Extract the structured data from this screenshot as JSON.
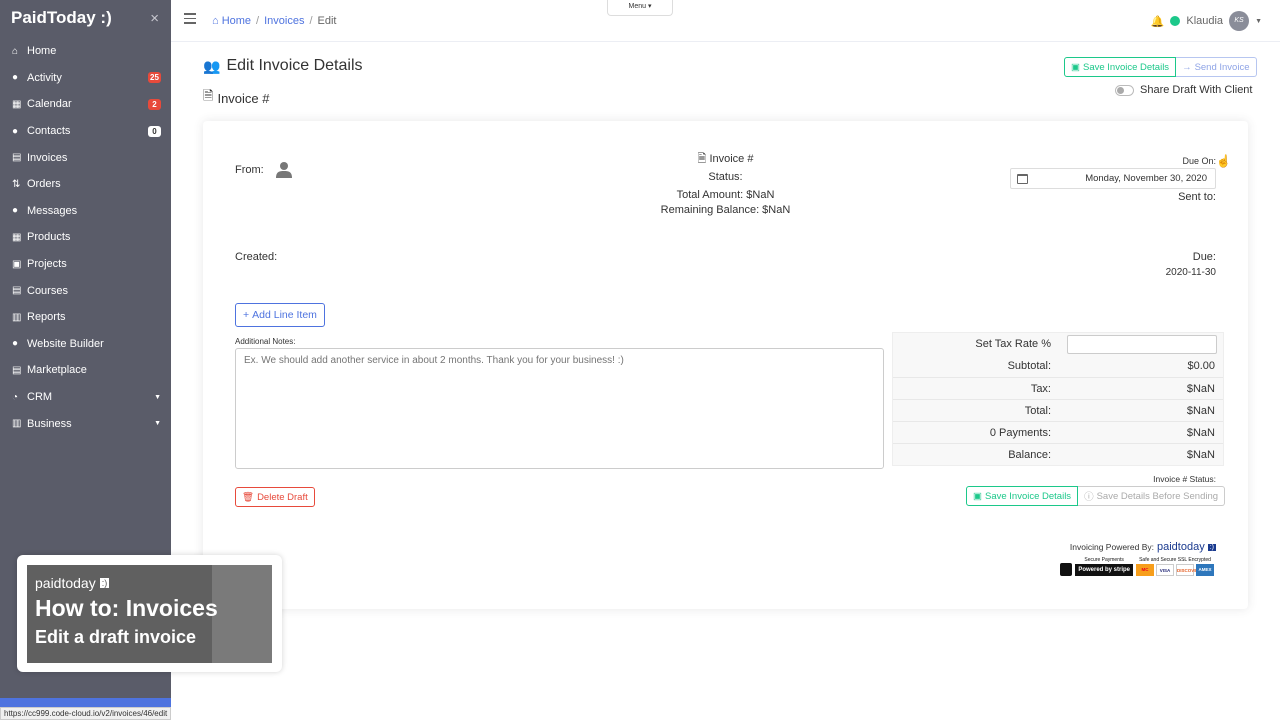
{
  "brand": {
    "title": "PaidToday :)",
    "close": "×"
  },
  "sidebar": {
    "items": [
      {
        "label": "Home",
        "icon": "home-icon",
        "glyph": "⌂"
      },
      {
        "label": "Activity",
        "icon": "bell-icon",
        "glyph": "●",
        "badge": "25"
      },
      {
        "label": "Calendar",
        "icon": "calendar-icon",
        "glyph": "▦",
        "badge": "2"
      },
      {
        "label": "Contacts",
        "icon": "users-icon",
        "glyph": "●",
        "badge": "0"
      },
      {
        "label": "Invoices",
        "icon": "file-invoice-icon",
        "glyph": "▤"
      },
      {
        "label": "Orders",
        "icon": "sort-icon",
        "glyph": "⇅"
      },
      {
        "label": "Messages",
        "icon": "comments-icon",
        "glyph": "●"
      },
      {
        "label": "Products",
        "icon": "boxes-icon",
        "glyph": "▦"
      },
      {
        "label": "Projects",
        "icon": "project-diagram-icon",
        "glyph": "▣"
      },
      {
        "label": "Courses",
        "icon": "book-icon",
        "glyph": "▤"
      },
      {
        "label": "Reports",
        "icon": "chart-icon",
        "glyph": "▥"
      },
      {
        "label": "Website Builder",
        "icon": "globe-icon",
        "glyph": "●"
      },
      {
        "label": "Marketplace",
        "icon": "store-icon",
        "glyph": "▤"
      },
      {
        "label": "CRM",
        "icon": "pie-chart-icon",
        "glyph": "◔",
        "caret": "▼"
      },
      {
        "label": "Business",
        "icon": "building-icon",
        "glyph": "▥",
        "caret": "▼"
      }
    ]
  },
  "topbar": {
    "breadcrumb": {
      "home": "Home",
      "invoices": "Invoices",
      "current": "Edit",
      "sep": "/"
    },
    "menu_tab": "Menu ▾",
    "user_name": "Klaudia",
    "avatar_initials": "KS",
    "bell_glyph": "🔔",
    "user_caret": "▼"
  },
  "page": {
    "title": "Edit Invoice Details",
    "title_icon": "👥",
    "subtitle": "Invoice #",
    "subtitle_icon": "🗎",
    "save_invoice_label": "Save Invoice Details",
    "send_invoice_label": "Send Invoice",
    "share_draft_label": "Share Draft With Client"
  },
  "invoice": {
    "from_label": "From:",
    "invoice_no": "Invoice #",
    "status_label": "Status:",
    "total_amount": "Total Amount: $NaN",
    "remaining_balance": "Remaining Balance: $NaN",
    "due_on_label": "Due On:",
    "due_on_value": "Monday, November 30, 2020",
    "sent_to_label": "Sent to:",
    "created_label": "Created:",
    "due_label": "Due:",
    "due_date": "2020-11-30",
    "add_line_item": "Add Line Item",
    "notes_label": "Additional Notes:",
    "notes_placeholder": "Ex. We should add another service in about 2 months. Thank you for your business! :)",
    "totals": {
      "tax_rate_label": "Set Tax Rate %",
      "tax_rate_value": "",
      "rows": [
        {
          "label": "Subtotal:",
          "value": "$0.00"
        },
        {
          "label": "Tax:",
          "value": "$NaN"
        },
        {
          "label": "Total:",
          "value": "$NaN"
        },
        {
          "label": "0 Payments:",
          "value": "$NaN"
        },
        {
          "label": "Balance:",
          "value": "$NaN"
        }
      ]
    },
    "status_caption": "Invoice # Status:",
    "delete_draft": "Delete Draft",
    "save_bottom": "Save Invoice Details",
    "save_before_sending": "Save Details Before Sending",
    "powered_by": "Invoicing Powered By:",
    "powered_brand": "paidtoday",
    "powered_mark": ":)",
    "secure_payments": "Secure Payments",
    "powered_stripe": "Powered by stripe",
    "ssl_caption": "Safe and Secure SSL Encrypted",
    "card_logos": [
      "MC",
      "VISA",
      "DISCOVER",
      "AMEX"
    ]
  },
  "tutorial": {
    "brand": "paidtoday",
    "brand_mark": ":)",
    "title": "How to: Invoices",
    "subtitle": "Edit a draft invoice"
  },
  "status_url": "https://cc999.code-cloud.io/v2/invoices/46/edit"
}
